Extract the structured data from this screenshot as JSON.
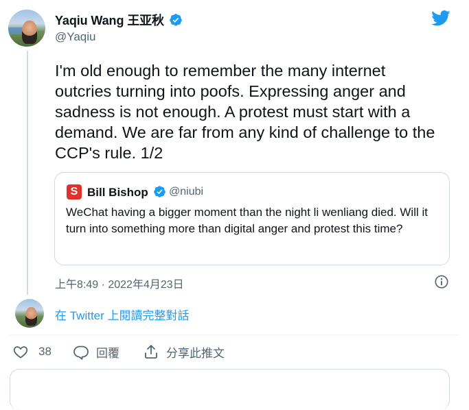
{
  "author": {
    "name": "Yaqiu Wang",
    "name_cn": "王亚秋",
    "handle": "@Yaqiu"
  },
  "tweet": {
    "text": "I'm old enough to remember the many internet outcries turning into poofs. Expressing anger and sadness is not  enough. A protest must start with a demand. We are far from any kind of challenge to the CCP's rule. 1/2",
    "timestamp": "上午8:49 · 2022年4月23日"
  },
  "quote": {
    "logo_letter": "S",
    "name": "Bill Bishop",
    "handle": "@niubi",
    "text": "WeChat having a bigger moment than the night li wenliang died. Will it turn into something more than digital anger and protest this time?"
  },
  "read_more": "在 Twitter 上閱讀完整對話",
  "actions": {
    "likes": "38",
    "reply_label": "回覆",
    "share_label": "分享此推文"
  },
  "colors": {
    "twitter_blue": "#1d9bf0",
    "text_primary": "#0f1419",
    "text_secondary": "#536471",
    "border": "#cfd9de"
  },
  "icons": [
    "twitter-bird-icon",
    "verified-badge-icon",
    "info-icon",
    "heart-icon",
    "reply-icon",
    "share-icon"
  ]
}
